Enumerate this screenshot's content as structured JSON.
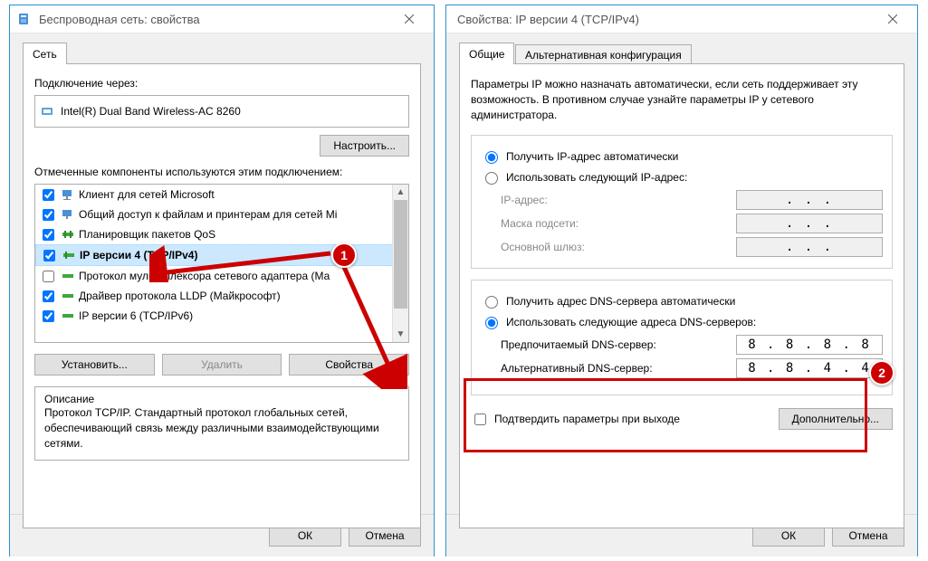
{
  "win1": {
    "title": "Беспроводная сеть: свойства",
    "tab": "Сеть",
    "connect_via": "Подключение через:",
    "adapter": "Intel(R) Dual Band Wireless-AC 8260",
    "configure": "Настроить...",
    "components_label": "Отмеченные компоненты используются этим подключением:",
    "items": [
      {
        "checked": true,
        "label": "Клиент для сетей Microsoft"
      },
      {
        "checked": true,
        "label": "Общий доступ к файлам и принтерам для сетей Mi"
      },
      {
        "checked": true,
        "label": "Планировщик пакетов QoS"
      },
      {
        "checked": true,
        "label": "IP версии 4 (TCP/IPv4)"
      },
      {
        "checked": false,
        "label": "Протокол мультиплексора сетевого адаптера (Ма"
      },
      {
        "checked": true,
        "label": "Драйвер протокола LLDP (Майкрософт)"
      },
      {
        "checked": true,
        "label": "IP версии 6 (TCP/IPv6)"
      }
    ],
    "install": "Установить...",
    "uninstall": "Удалить",
    "properties": "Свойства",
    "desc_label": "Описание",
    "desc": "Протокол TCP/IP. Стандартный протокол глобальных сетей, обеспечивающий связь между различными взаимодействующими сетями.",
    "ok": "ОК",
    "cancel": "Отмена"
  },
  "win2": {
    "title": "Свойства: IP версии 4 (TCP/IPv4)",
    "tab1": "Общие",
    "tab2": "Альтернативная конфигурация",
    "info": "Параметры IP можно назначать автоматически, если сеть поддерживает эту возможность. В противном случае узнайте параметры IP у сетевого администратора.",
    "auto_ip": "Получить IP-адрес автоматически",
    "manual_ip": "Использовать следующий IP-адрес:",
    "ip_label": "IP-адрес:",
    "mask_label": "Маска подсети:",
    "gateway_label": "Основной шлюз:",
    "dots": ".       .       .",
    "auto_dns": "Получить адрес DNS-сервера автоматически",
    "manual_dns": "Использовать следующие адреса DNS-серверов:",
    "dns1_label": "Предпочитаемый DNS-сервер:",
    "dns2_label": "Альтернативный DNS-сервер:",
    "dns1": "8 . 8 . 8 . 8",
    "dns2": "8 . 8 . 4 . 4",
    "confirm_exit": "Подтвердить параметры при выходе",
    "advanced": "Дополнительно...",
    "ok": "ОК",
    "cancel": "Отмена"
  },
  "callouts": {
    "one": "1",
    "two": "2"
  }
}
